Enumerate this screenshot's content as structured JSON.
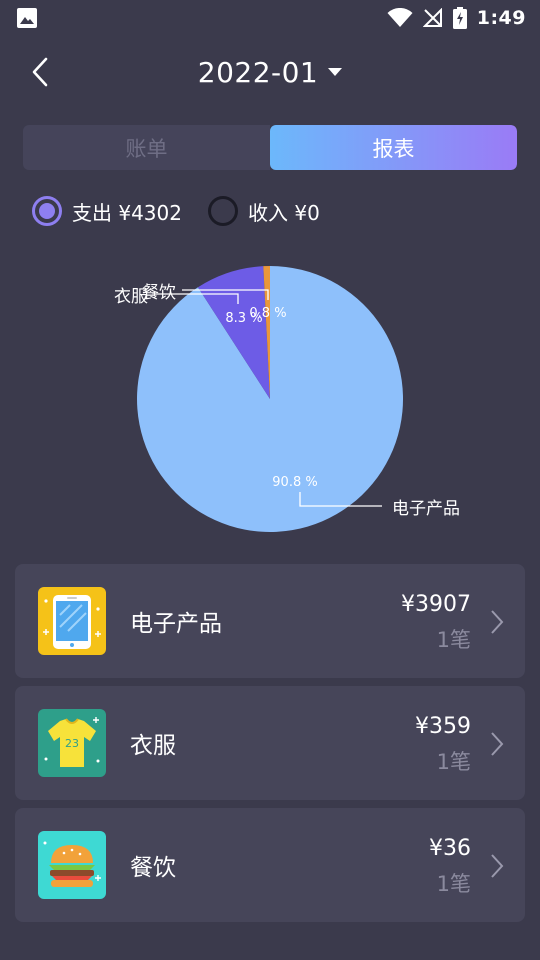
{
  "status_bar": {
    "time": "1:49"
  },
  "header": {
    "month": "2022-01"
  },
  "tabs": [
    {
      "label": "账单",
      "active": false
    },
    {
      "label": "报表",
      "active": true
    }
  ],
  "type_filter": {
    "expense_label": "支出 ¥4302",
    "income_label": "收入 ¥0",
    "selected": "expense"
  },
  "chart_data": {
    "type": "pie",
    "slices": [
      {
        "label": "电子产品",
        "value": 90.8,
        "value_label": "90.8 %",
        "color": "#8ec0fb"
      },
      {
        "label": "衣服",
        "value": 8.3,
        "value_label": "8.3 %",
        "color": "#6d5ce6"
      },
      {
        "label": "餐饮",
        "value": 0.8,
        "value_label": "0.8 %",
        "color": "#e9973b"
      }
    ]
  },
  "categories": [
    {
      "name": "电子产品",
      "amount": "¥3907",
      "count": "1笔",
      "icon": "phone-icon"
    },
    {
      "name": "衣服",
      "amount": "¥359",
      "count": "1笔",
      "icon": "tshirt-icon"
    },
    {
      "name": "餐饮",
      "amount": "¥36",
      "count": "1笔",
      "icon": "burger-icon"
    }
  ],
  "jersey_number": "23",
  "colors": {
    "background": "#3b3a4c",
    "card": "#464559",
    "accent": "#8e7ff0"
  }
}
